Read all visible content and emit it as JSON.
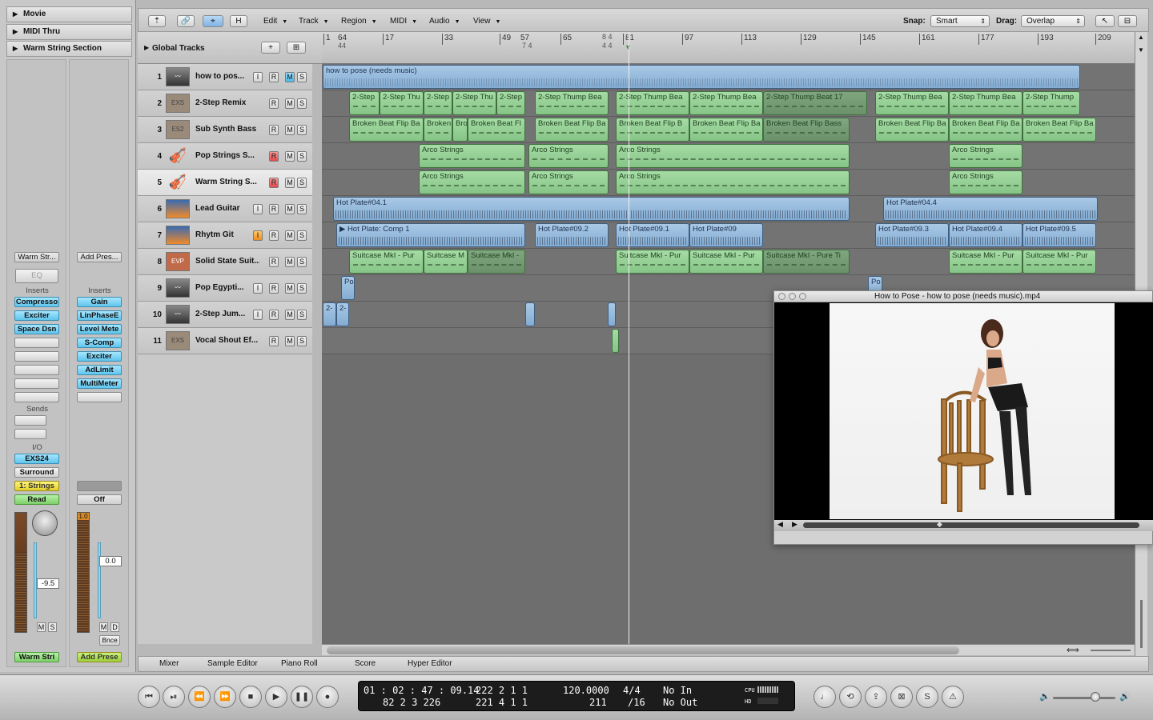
{
  "inspector": {
    "headers": [
      "Movie",
      "MIDI Thru",
      "Warm String Section"
    ],
    "strip1": {
      "name_btn": "Warm Str...",
      "eq": "EQ",
      "inserts_label": "Inserts",
      "inserts": [
        "Compresso",
        "Exciter",
        "Space Dsn",
        "",
        "",
        "",
        "",
        ""
      ],
      "sends_label": "Sends",
      "io_label": "I/O",
      "instrument": "EXS24",
      "output": "Surround",
      "group": "1: Strings",
      "automation": "Read",
      "peak": "",
      "volume": "-9.5",
      "mute": "M",
      "solo": "S",
      "name": "Warm Stri"
    },
    "strip2": {
      "name_btn": "Add Pres...",
      "inserts_label": "Inserts",
      "inserts": [
        "Gain",
        "LinPhaseE",
        "Level Mete",
        "S-Comp",
        "Exciter",
        "AdLimit",
        "MultiMeter",
        ""
      ],
      "automation": "Off",
      "peak": "1.0",
      "volume": "0.0",
      "mute": "M",
      "dim": "D",
      "bounce": "Bnce",
      "name": "Add Prese"
    }
  },
  "toolbar": {
    "buttons": [
      "⇡",
      "🔗",
      "⌖",
      "H"
    ],
    "menus": [
      "Edit",
      "Track",
      "Region",
      "MIDI",
      "Audio",
      "View"
    ],
    "snap_label": "Snap:",
    "snap_value": "Smart",
    "drag_label": "Drag:",
    "drag_value": "Overlap"
  },
  "global_tracks": {
    "label": "Global Tracks"
  },
  "ruler": {
    "marks": [
      "1",
      "64",
      "17",
      "33",
      "49",
      "57",
      "65",
      "81",
      "97",
      "113",
      "129",
      "145",
      "161",
      "177",
      "193",
      "209"
    ],
    "sig_top": "44",
    "sig_mid": "7 4",
    "sig_84": "8 4",
    "sig_84b": "4 4"
  },
  "tracks": [
    {
      "num": "1",
      "name": "how to pos...",
      "icon": "waveform-icon",
      "icon_text": "",
      "btns": [
        "I",
        "R",
        "M",
        "S"
      ]
    },
    {
      "num": "2",
      "name": "2-Step Remix",
      "icon": "exs-icon",
      "icon_text": "EXS",
      "btns": [
        "R",
        "M",
        "S"
      ]
    },
    {
      "num": "3",
      "name": "Sub Synth Bass",
      "icon": "es2-icon",
      "icon_text": "ES2",
      "btns": [
        "R",
        "M",
        "S"
      ]
    },
    {
      "num": "4",
      "name": "Pop Strings S...",
      "icon": "violin-icon",
      "icon_text": "🎻",
      "btns": [
        "R",
        "M",
        "S"
      ]
    },
    {
      "num": "5",
      "name": "Warm String S...",
      "icon": "violin-icon",
      "icon_text": "🎻",
      "btns": [
        "R",
        "M",
        "S"
      ]
    },
    {
      "num": "6",
      "name": "Lead Guitar",
      "icon": "guitar-amp-icon",
      "icon_text": "",
      "btns": [
        "I",
        "R",
        "M",
        "S"
      ]
    },
    {
      "num": "7",
      "name": "Rhytm Git",
      "icon": "guitar-amp-icon",
      "icon_text": "",
      "btns": [
        "I",
        "R",
        "M",
        "S"
      ]
    },
    {
      "num": "8",
      "name": "Solid State Suit...",
      "icon": "evp-icon",
      "icon_text": "EVP",
      "btns": [
        "R",
        "M",
        "S"
      ]
    },
    {
      "num": "9",
      "name": "Pop Egypti...",
      "icon": "waveform-icon",
      "icon_text": "",
      "btns": [
        "I",
        "R",
        "M",
        "S"
      ]
    },
    {
      "num": "10",
      "name": "2-Step Jum...",
      "icon": "waveform-icon",
      "icon_text": "",
      "btns": [
        "I",
        "R",
        "M",
        "S"
      ]
    },
    {
      "num": "11",
      "name": "Vocal Shout Ef...",
      "icon": "exs-icon",
      "icon_text": "EXS",
      "btns": [
        "R",
        "M",
        "S"
      ]
    }
  ],
  "regions": {
    "t1": "how to pose (needs music)",
    "t2": [
      "2-Step",
      "2-Step Thu",
      "2-Step",
      "2-Step Thu",
      "2-Step",
      "2-Step Thump Bea",
      "2-Step Thump Bea",
      "2-Step Thump Bea",
      "2-Step Thump Beat 17",
      "2-Step Thump Bea",
      "2-Step Thump Bea",
      "2-Step Thump"
    ],
    "t3": [
      "Broken Beat Flip Ba",
      "Broken",
      "Bro",
      "Broken Beat Fl",
      "Broken Beat Flip Ba",
      "Broken Beat Flip B",
      "Broken Beat Flip Ba",
      "Broken Beat Flip Bass",
      "Broken Beat Flip Ba",
      "Broken Beat Flip Ba",
      "Broken Beat Flip Ba"
    ],
    "t4": [
      "Arco Strings",
      "Arco Strings",
      "Arco Strings",
      "Arco Strings"
    ],
    "t5": [
      "Arco Strings",
      "Arco Strings",
      "Arco Strings",
      "Arco Strings"
    ],
    "t6": [
      "Hot Plate#04.1",
      "Hot Plate#04.4"
    ],
    "t7": [
      "▶ Hot Plate: Comp 1",
      "Hot Plate#09.2",
      "Hot Plate#09.1",
      "Hot Plate#09",
      "Hot Plate#09.3",
      "Hot Plate#09.4",
      "Hot Plate#09.5"
    ],
    "t8": [
      "Suitcase MkI - Pur",
      "Suitcase M",
      "Suitcase MkI -",
      "Suitcase MkI - Pur",
      "Suitcase MkI - Pur",
      "Suitcase MkI - Pure Ti",
      "Suitcase MkI - Pur",
      "Suitcase MkI - Pur"
    ],
    "t9": [
      "Po",
      "Po"
    ],
    "t10": [
      "2-",
      "2-"
    ]
  },
  "tabs": [
    "Mixer",
    "Sample Editor",
    "Piano Roll",
    "Score",
    "Hyper Editor"
  ],
  "video": {
    "title": "How to Pose  - how to pose (needs music).mp4"
  },
  "transport": {
    "smpte": "01 : 02 : 47 : 09.14",
    "bbt_pos": "222    2    1       1",
    "bbt_sub": "82    2    3  226",
    "bbt_end": "221    4    1       1",
    "tempo": "120.0000",
    "tempo_sub": "211",
    "sig": "4/4",
    "div": "/16",
    "in": "No In",
    "out": "No Out",
    "cpu": "CPU",
    "hd": "HD"
  },
  "colors": {
    "accent": "#5fc4ec",
    "region_green": "#a5dca5",
    "region_blue": "#a9c9e6"
  }
}
